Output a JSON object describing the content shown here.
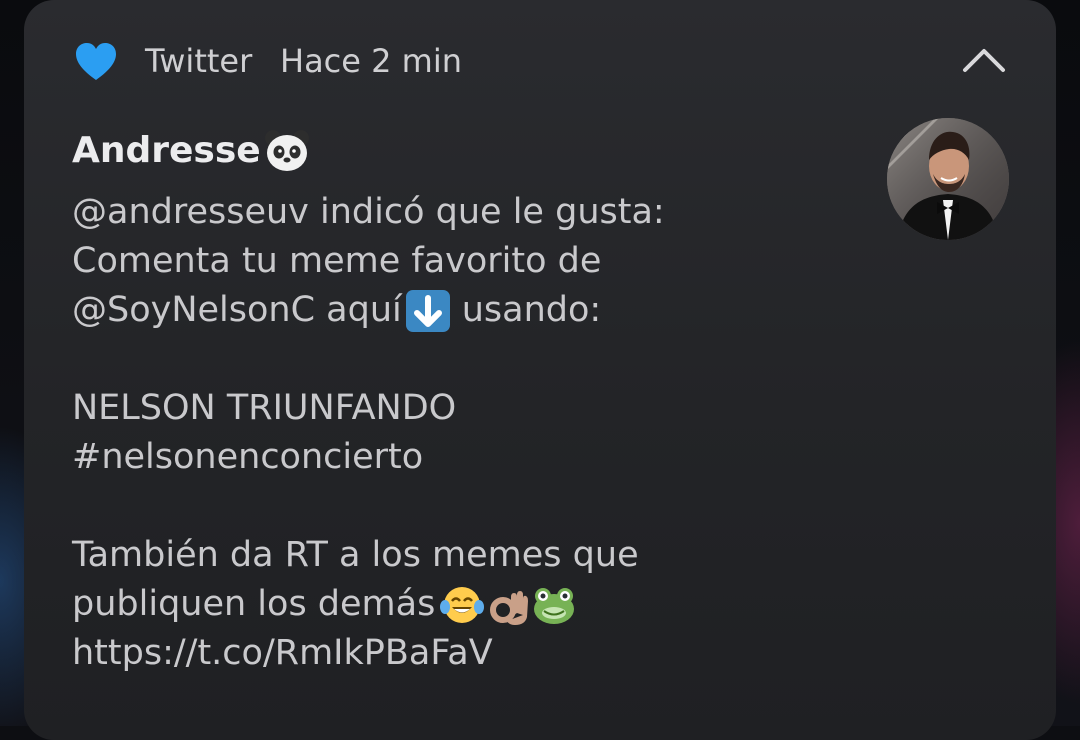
{
  "notification": {
    "app_name": "Twitter",
    "time": "Hace 2 min",
    "sender": "Andresse",
    "message_lines": [
      "@andresseuv indicó que le gusta:",
      "Comenta tu meme favorito de",
      "@SoyNelsonC aquí",
      "usando:",
      "NELSON TRIUNFANDO",
      "#nelsonenconcierto",
      "También da RT a los memes que",
      "publiquen los demás",
      "https://t.co/RmIkPBaFaV"
    ],
    "icons": {
      "app": "blue-heart-icon",
      "collapse": "chevron-up-icon",
      "sender_emoji": "panda-face-icon",
      "arrow_emoji": "down-arrow-emoji-icon",
      "laugh_emoji": "tears-of-joy-emoji-icon",
      "ok_emoji": "ok-hand-emoji-icon",
      "frog_emoji": "frog-face-emoji-icon"
    },
    "colors": {
      "card_bg": "#2a2b2f",
      "heart_blue": "#1da1f2",
      "text_primary": "#ececee",
      "text_secondary": "#c9c9cc"
    }
  }
}
